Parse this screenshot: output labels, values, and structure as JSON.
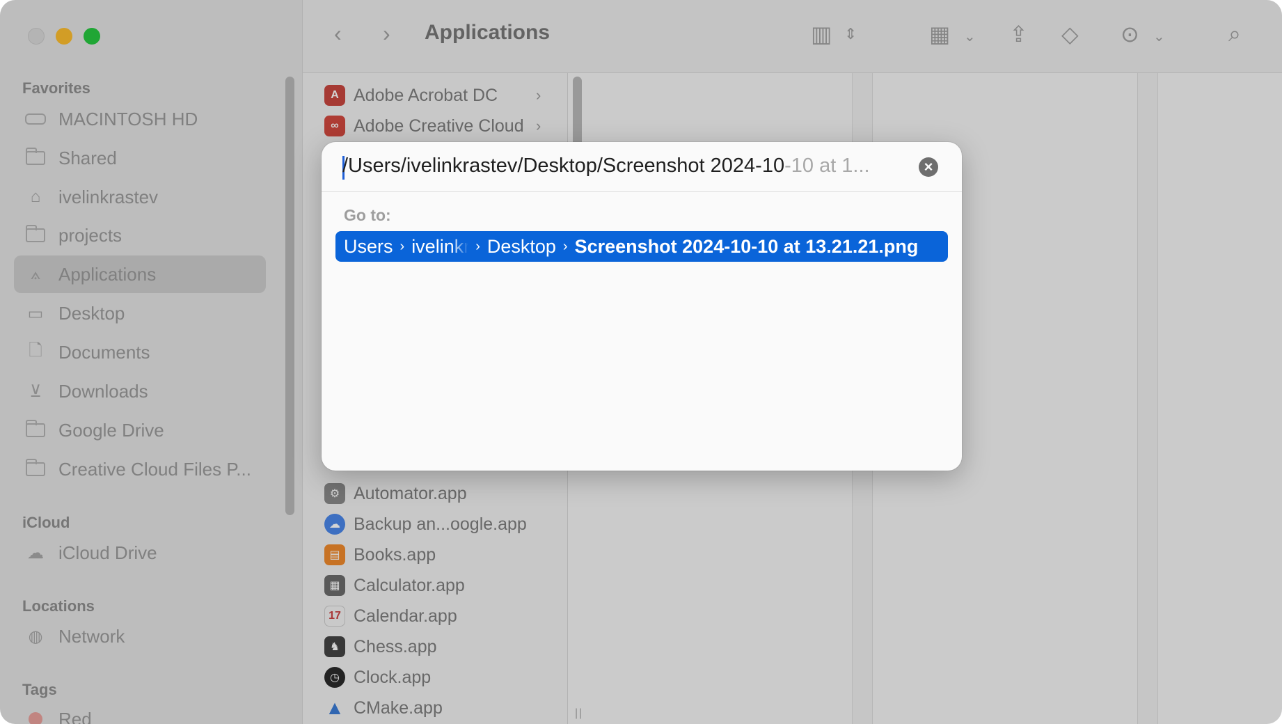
{
  "window": {
    "title": "Applications"
  },
  "sidebar": {
    "favorites_heading": "Favorites",
    "favorites": [
      {
        "label": "MACINTOSH HD",
        "icon": "drive-icon"
      },
      {
        "label": "Shared",
        "icon": "folder-icon"
      },
      {
        "label": "ivelinkrastev",
        "icon": "home-icon"
      },
      {
        "label": "projects",
        "icon": "folder-icon"
      },
      {
        "label": "Applications",
        "icon": "applications-icon",
        "selected": true
      },
      {
        "label": "Desktop",
        "icon": "desktop-icon"
      },
      {
        "label": "Documents",
        "icon": "document-icon"
      },
      {
        "label": "Downloads",
        "icon": "download-icon"
      },
      {
        "label": "Google Drive",
        "icon": "folder-icon"
      },
      {
        "label": "Creative Cloud Files P...",
        "icon": "folder-icon"
      }
    ],
    "icloud_heading": "iCloud",
    "icloud": [
      {
        "label": "iCloud Drive",
        "icon": "cloud-icon"
      }
    ],
    "locations_heading": "Locations",
    "locations": [
      {
        "label": "Network",
        "icon": "globe-icon"
      }
    ],
    "tags_heading": "Tags",
    "tags": [
      {
        "label": "Red",
        "color": "#e8a09c"
      }
    ]
  },
  "files": [
    {
      "label": "Adobe Acrobat DC",
      "icon": "acrobat-icon",
      "color": "#c8463f",
      "folder": true
    },
    {
      "label": "Adobe Creative Cloud",
      "icon": "creative-cloud-icon",
      "color": "#d2493f",
      "folder": true
    },
    {
      "label": "Automator.app",
      "icon": "automator-icon",
      "color": "#8a8a8a"
    },
    {
      "label": "Backup an...oogle.app",
      "icon": "google-backup-icon",
      "color": "#4a86e8"
    },
    {
      "label": "Books.app",
      "icon": "books-icon",
      "color": "#f08a2c"
    },
    {
      "label": "Calculator.app",
      "icon": "calculator-icon",
      "color": "#6b6b6b"
    },
    {
      "label": "Calendar.app",
      "icon": "calendar-icon",
      "color": "#f2f2f2"
    },
    {
      "label": "Chess.app",
      "icon": "chess-icon",
      "color": "#444444"
    },
    {
      "label": "Clock.app",
      "icon": "clock-icon",
      "color": "#2b2b2b"
    },
    {
      "label": "CMake.app",
      "icon": "cmake-icon",
      "color": "#3a7bd5"
    }
  ],
  "dialog": {
    "path_typed": "/Users/ivelinkrastev/Desktop/Screenshot 2024-10",
    "path_suggestion": "-10 at 1...",
    "clear_symbol": "×",
    "goto_label": "Go to:",
    "result": {
      "crumbs": [
        "Users",
        "ivelinkr",
        "Desktop"
      ],
      "final": "Screenshot 2024-10-10 at 13.21.21.png",
      "separator": "›"
    }
  },
  "colors": {
    "accent": "#0a64d9",
    "close": "#d9d9d9",
    "minimize": "#fdbd2e",
    "maximize": "#27c840"
  }
}
